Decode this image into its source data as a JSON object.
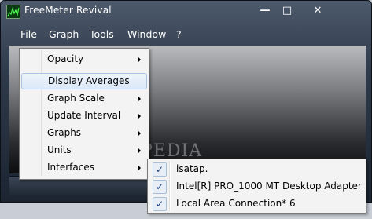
{
  "window": {
    "title": "FreeMeter Revival",
    "controls": {
      "minimize": "—",
      "maximize": "□",
      "close": "✕"
    }
  },
  "menubar": [
    "File",
    "Graph",
    "Tools",
    "Window",
    "?"
  ],
  "context_menu": {
    "items": [
      {
        "label": "Opacity",
        "submenu": true
      },
      {
        "label": "Display Averages",
        "submenu": false,
        "highlighted": true
      },
      {
        "label": "Graph Scale",
        "submenu": true
      },
      {
        "label": "Update Interval",
        "submenu": true
      },
      {
        "label": "Graphs",
        "submenu": true
      },
      {
        "label": "Units",
        "submenu": true
      },
      {
        "label": "Interfaces",
        "submenu": true
      }
    ]
  },
  "interfaces_submenu": {
    "items": [
      {
        "label": "isatap.",
        "checked": true
      },
      {
        "label": "Intel[R] PRO_1000 MT Desktop Adapter",
        "checked": true
      },
      {
        "label": "Local Area Connection* 6",
        "checked": true
      }
    ]
  },
  "watermark": "SOFTPEDIA",
  "icons": {
    "check": "✓",
    "app": "freemeter-graph-icon"
  },
  "colors": {
    "titlebar": "#4d5a6c",
    "highlight": "#dbe8f7",
    "menu_bg": "#f3f3f3"
  }
}
